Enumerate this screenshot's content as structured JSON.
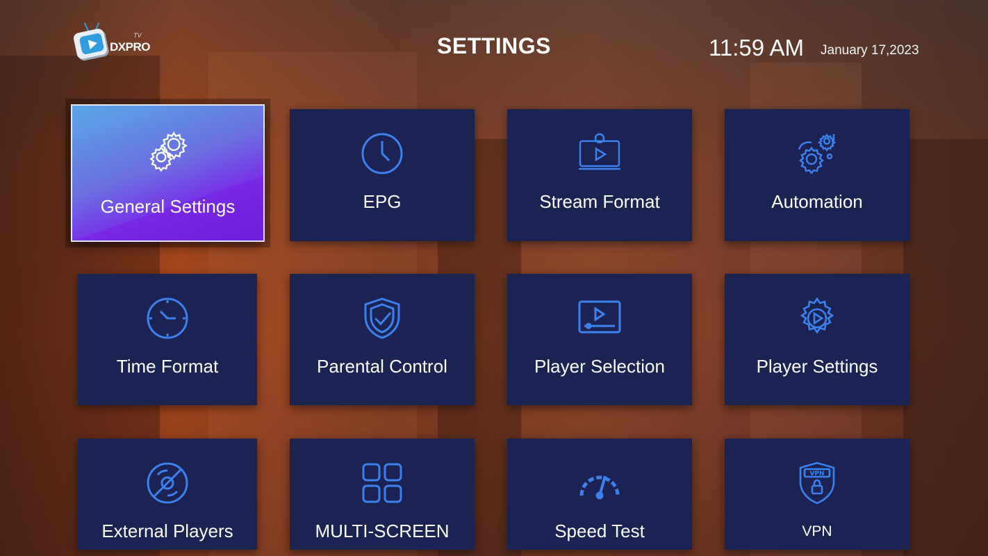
{
  "header": {
    "logo_text": "DXPRO",
    "logo_sup": "TV",
    "title": "SETTINGS",
    "time": "11:59 AM",
    "date": "January 17,2023"
  },
  "tiles": [
    {
      "label": "General Settings",
      "icon": "gears-icon",
      "active": true
    },
    {
      "label": "EPG",
      "icon": "clock-icon"
    },
    {
      "label": "Stream Format",
      "icon": "stream-monitor-icon"
    },
    {
      "label": "Automation",
      "icon": "automation-gears-icon"
    },
    {
      "label": "Time Format",
      "icon": "time-clock-icon"
    },
    {
      "label": "Parental Control",
      "icon": "shield-check-icon"
    },
    {
      "label": "Player Selection",
      "icon": "player-screen-icon"
    },
    {
      "label": "Player Settings",
      "icon": "gear-play-icon"
    },
    {
      "label": "External Players",
      "icon": "disc-slash-icon"
    },
    {
      "label": "MULTI-SCREEN",
      "icon": "grid-four-icon"
    },
    {
      "label": "Speed Test",
      "icon": "speedometer-icon"
    },
    {
      "label": "VPN",
      "icon": "vpn-shield-icon"
    }
  ],
  "colors": {
    "tile_bg": "#1b2352",
    "icon_blue": "#3b82f0",
    "active_top": "#5aa8e8",
    "active_bottom": "#7a2fe8"
  }
}
